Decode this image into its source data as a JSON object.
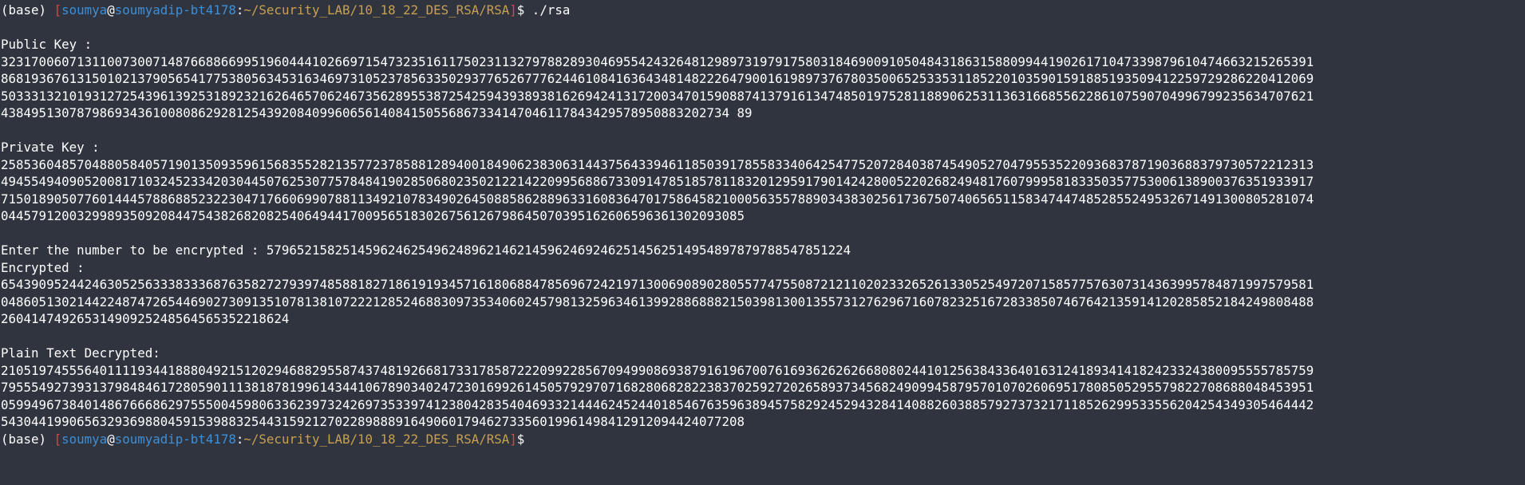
{
  "terminal": {
    "env": "(base)",
    "prompt_open": "[",
    "user": "soumya",
    "at": "@",
    "host": "soumyadip-bt4178",
    "colon": ":",
    "path": "~/Security_LAB/10_18_22_DES_RSA/RSA",
    "prompt_close": "]",
    "dollar": "$",
    "command": " ./rsa",
    "public_key_label": "Public Key :",
    "public_key_lines": [
      "32317006071311007300714876688669951960444102669715473235161175023113279788289304695542432648129897319791758031846900910504843186315880994419026171047339879610474663215265391",
      "86819367613150102137905654177538056345316346973105237856335029377652677762446108416364348148222647900161989737678035006525335311852201035901591885193509412259729286220412069",
      "50333132101931272543961392531892321626465706246735628955387254259439389381626942413172003470159088741379161347485019752811889062531136316685562286107590704996799235634707621",
      "438495130787986934361008086292812543920840996065614084150556867334147046117843429578950883202734 89"
    ],
    "private_key_label": "Private Key :",
    "private_key_lines": [
      "25853604857048805840571901350935961568355282135772378588128940018490623830631443756433946118503917855833406425477520728403874549052704795535220936837871903688379730572212313",
      "49455494090520081710324523342030445076253077578484190285068023502122142209956886733091478518578118320129591790142428005220268249481760799958183350357753006138900376351933917",
      "71501890507760144457886885232230471766069907881134921078349026450885862889633160836470175864582100056355788903438302561736750740656511583474474852855249532671491300805281074",
      "04457912003299893509208447543826820825406494417009565183026756126798645070395162606596361302093085"
    ],
    "enter_label": "Enter the number to be encrypted : ",
    "enter_value": "57965215825145962462549624896214621459624692462514562514954897879788547851224",
    "encrypted_label": "Encrypted :",
    "encrypted_lines": [
      "65439095244246305256333833368763582727939748588182718619193457161806884785696724219713006908902805577475508721211020233265261330525497207158577576307314363995784871997579581",
      "04860513021442248747265446902730913510781381072221285246883097353406024579813259634613992886888215039813001355731276296716078232516728338507467642135914120285852184249808488",
      "26041474926531490925248564565352218624"
    ],
    "decrypted_label": "Plain Text Decrypted:",
    "decrypted_lines": [
      "21051974555640111193441888049215120294688295587437481926681733178587222099228567094990869387916196700761693626262668080244101256384336401631241893414182423324380095555785759",
      "79555492739313798484617280590111381878199614344106789034024723016992614505792970716828068282238370259272026589373456824909945879570107026069517808505295579822708688048453951",
      "05994967384014867666862975550045980633623973242697353397412380428354046933214446245244018546763596389457582924529432841408826038857927373217118526299533556204254349305464442",
      "54304419906563293698804591539883254431592127022898889164906017946273356019961498412912094424077208"
    ]
  }
}
